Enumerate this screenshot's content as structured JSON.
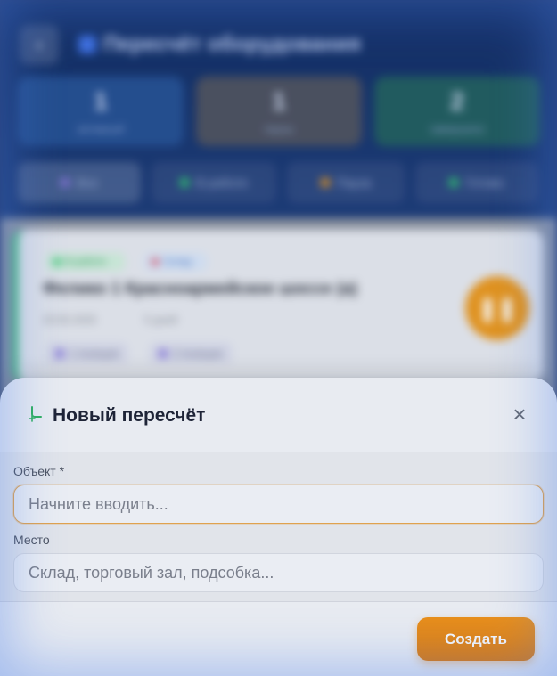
{
  "background": {
    "header": {
      "back_icon": "arrow-left-icon",
      "title": "Пересчёт оборудования"
    },
    "stats": [
      {
        "value": "1",
        "label": "активный"
      },
      {
        "value": "1",
        "label": "паузы"
      },
      {
        "value": "2",
        "label": "завершено"
      }
    ],
    "filters": [
      {
        "label": "Все",
        "color": "#8a78d8"
      },
      {
        "label": "В работе",
        "color": "#2fc46a"
      },
      {
        "label": "Пауза",
        "color": "#e79418"
      },
      {
        "label": "Готово",
        "color": "#2fc46a"
      }
    ],
    "card": {
      "status_badge": "В работе",
      "type_badge": "Склад",
      "title": "Фелико 1 Красноармейское шоссе (а)",
      "date": "20.05.2025",
      "duration": "5 дней",
      "chips": [
        "1 позиция",
        "2 позиции"
      ],
      "fab_icon": "pause-icon"
    }
  },
  "modal": {
    "icon": "sparkle-icon",
    "title": "Новый пересчёт",
    "close_icon": "close-icon",
    "fields": [
      {
        "label": "Объект *",
        "placeholder": "Начните вводить...",
        "value": ""
      },
      {
        "label": "Место",
        "placeholder": "Склад, торговый зал, подсобка...",
        "value": ""
      }
    ],
    "submit_label": "Создать"
  },
  "colors": {
    "accent": "#f29112",
    "focus_border": "#e8a548",
    "header_bg": "#0f2a5e"
  }
}
